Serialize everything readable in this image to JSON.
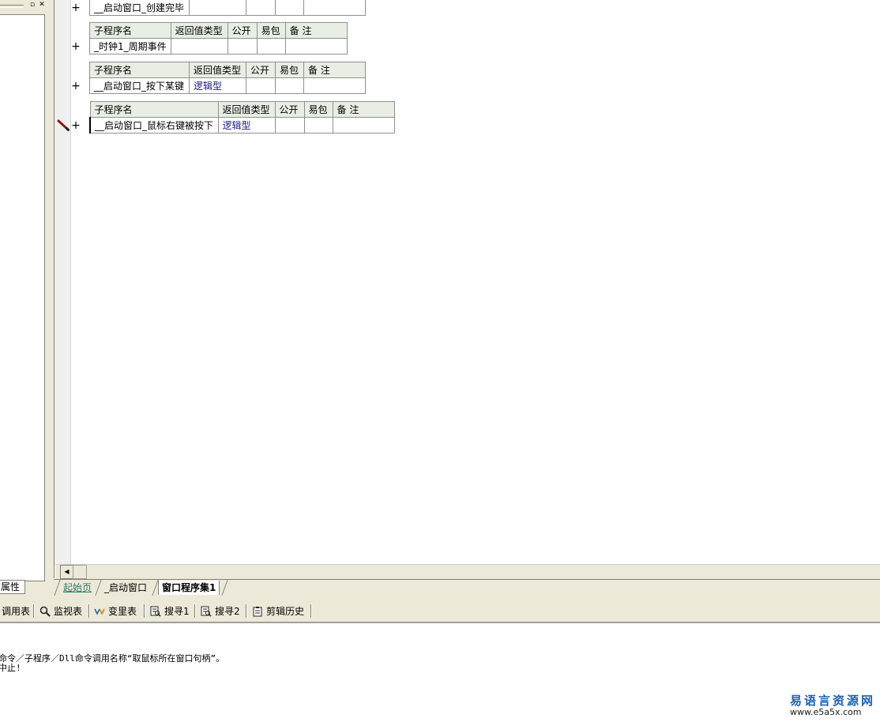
{
  "left_panel": {
    "pin_glyph": "▫",
    "close_glyph": "✕",
    "tab_label": "属性"
  },
  "editor": {
    "header": {
      "name": "子程序名",
      "return_type": "返回值类型",
      "public": "公开",
      "easy_pack": "易包",
      "note": "备 注"
    },
    "plus_glyph": "+",
    "subroutines": [
      {
        "name": "__启动窗口_创建完毕",
        "return_type": ""
      },
      {
        "name": "_时钟1_周期事件",
        "return_type": ""
      },
      {
        "name": "__启动窗口_按下某键",
        "return_type": "逻辑型"
      },
      {
        "name": "__启动窗口_鼠标右键被按下",
        "return_type": "逻辑型"
      }
    ]
  },
  "scrollbar": {
    "left_arrow": "◀"
  },
  "doc_tabs": [
    {
      "label": "起始页"
    },
    {
      "label": "_启动窗口"
    },
    {
      "label": "窗口程序集1"
    }
  ],
  "bottom_tabs": [
    {
      "label": "调用表",
      "icon": "call-table-icon"
    },
    {
      "label": "监视表",
      "icon": "magnifier-icon"
    },
    {
      "label": "变里表",
      "icon": "variable-icon"
    },
    {
      "label": "搜寻1",
      "icon": "search-list-icon"
    },
    {
      "label": "搜寻2",
      "icon": "search-list-icon"
    },
    {
      "label": "剪辑历史",
      "icon": "clipboard-icon"
    }
  ],
  "output": {
    "lines": [
      "命令／子程序／Dll命令调用名称“取鼠标所在窗口句柄”。",
      "中止!"
    ]
  },
  "watermark": {
    "title": "易语言资源网",
    "url": "www.e5a5x.com"
  },
  "colors": {
    "header_bg": "#e8eee4",
    "return_type_text": "#1a1a8c",
    "start_tab_text": "#2a7a6a",
    "watermark_blue": "#1a5fb4",
    "pencil": "#8b1a1a"
  }
}
